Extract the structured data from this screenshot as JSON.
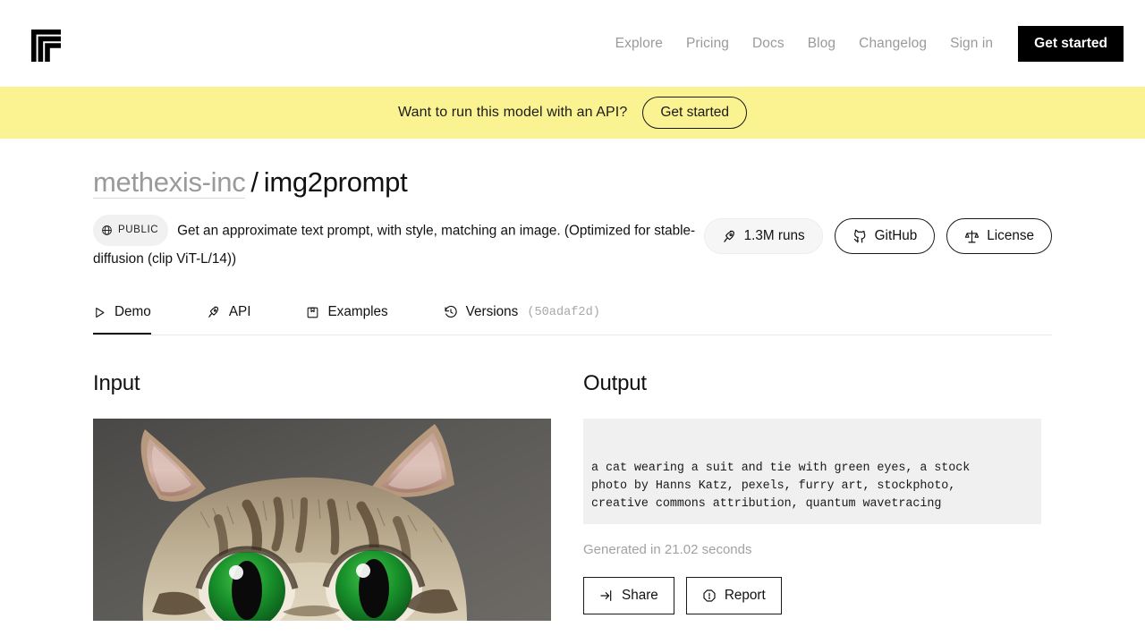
{
  "nav": {
    "logo_icon": "replicate-logo-icon",
    "links": [
      {
        "label": "Explore",
        "name": "nav-link-explore"
      },
      {
        "label": "Pricing",
        "name": "nav-link-pricing"
      },
      {
        "label": "Docs",
        "name": "nav-link-docs"
      },
      {
        "label": "Blog",
        "name": "nav-link-blog"
      },
      {
        "label": "Changelog",
        "name": "nav-link-changelog"
      },
      {
        "label": "Sign in",
        "name": "nav-link-signin"
      }
    ],
    "cta_label": "Get started"
  },
  "api_banner": {
    "text": "Want to run this model with an API?",
    "button_label": "Get started",
    "background": "#FBF391"
  },
  "model": {
    "owner": "methexis-inc",
    "separator": "/",
    "name": "img2prompt",
    "visibility_badge": "PUBLIC",
    "visibility_icon": "globe-icon",
    "description": "Get an approximate text prompt, with style, matching an image. (Optimized for stable-diffusion (clip ViT-L/14))",
    "stats": [
      {
        "label": "1.3M runs",
        "icon": "rocket-icon",
        "name": "runs-pill",
        "style": "soft"
      },
      {
        "label": "GitHub",
        "icon": "github-icon",
        "name": "github-pill",
        "style": "outline"
      },
      {
        "label": "License",
        "icon": "scales-icon",
        "name": "license-pill",
        "style": "outline"
      }
    ]
  },
  "tabs": [
    {
      "label": "Demo",
      "icon": "play-triangle-icon",
      "active": true,
      "name": "tab-demo"
    },
    {
      "label": "API",
      "icon": "rocket-icon",
      "active": false,
      "name": "tab-api"
    },
    {
      "label": "Examples",
      "icon": "bookmark-square-icon",
      "active": false,
      "name": "tab-examples"
    },
    {
      "label": "Versions",
      "icon": "history-clock-icon",
      "active": false,
      "name": "tab-versions",
      "hash": "(50adaf2d)"
    }
  ],
  "input": {
    "title": "Input",
    "image_alt": "close-up photo of a tabby cat with bright green eyes on a gray background"
  },
  "output": {
    "title": "Output",
    "text": "a cat wearing a suit and tie with green eyes, a stock\nphoto by Hanns Katz, pexels, furry art, stockphoto,\ncreative commons attribution, quantum wavetracing",
    "generated_time": "Generated in 21.02 seconds",
    "actions": [
      {
        "label": "Share",
        "icon": "share-arrow-icon",
        "name": "share-button"
      },
      {
        "label": "Report",
        "icon": "alert-octagon-icon",
        "name": "report-button"
      }
    ],
    "background": "#f0f0f0"
  }
}
